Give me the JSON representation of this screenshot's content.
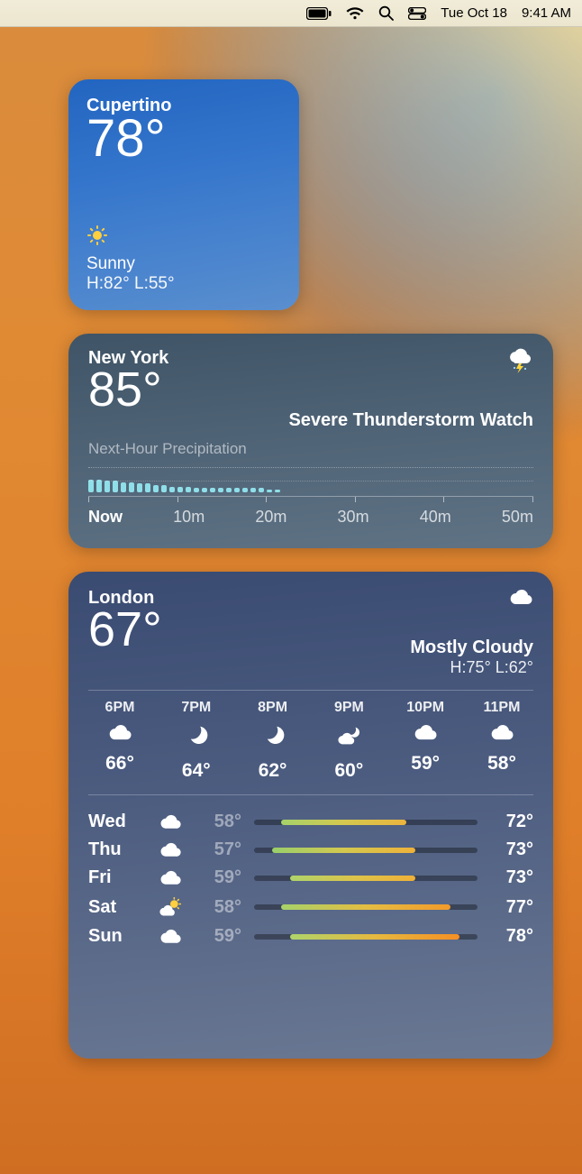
{
  "menubar": {
    "date": "Tue Oct 18",
    "time": "9:41 AM"
  },
  "widgets": {
    "small": {
      "location": "Cupertino",
      "temp": "78°",
      "icon": "sun-icon",
      "condition": "Sunny",
      "hilo": "H:82° L:55°"
    },
    "medium": {
      "location": "New York",
      "temp": "85°",
      "icon": "thunderstorm-icon",
      "alert": "Severe Thunderstorm Watch",
      "precip_label": "Next-Hour Precipitation",
      "precip_axis": [
        "Now",
        "10m",
        "20m",
        "30m",
        "40m",
        "50m"
      ],
      "precip_bars": [
        9,
        9,
        8,
        8,
        7,
        7,
        6,
        6,
        5,
        5,
        4,
        4,
        4,
        3,
        3,
        3,
        3,
        3,
        3,
        3,
        3,
        3,
        2,
        2
      ]
    },
    "large": {
      "location": "London",
      "temp": "67°",
      "icon": "cloud-icon",
      "condition": "Mostly Cloudy",
      "hilo": "H:75° L:62°",
      "hourly": [
        {
          "hour": "6PM",
          "icon": "cloud-icon",
          "temp": "66°"
        },
        {
          "hour": "7PM",
          "icon": "moon-stars-icon",
          "temp": "64°"
        },
        {
          "hour": "8PM",
          "icon": "moon-stars-icon",
          "temp": "62°"
        },
        {
          "hour": "9PM",
          "icon": "cloud-moon-icon",
          "temp": "60°"
        },
        {
          "hour": "10PM",
          "icon": "cloud-icon",
          "temp": "59°"
        },
        {
          "hour": "11PM",
          "icon": "cloud-icon",
          "temp": "58°"
        }
      ],
      "daily_scale": {
        "min": 55,
        "max": 80
      },
      "daily": [
        {
          "day": "Wed",
          "icon": "cloud-icon",
          "lo": 58,
          "hi": 72,
          "lo_text": "58°",
          "hi_text": "72°",
          "gradient": "linear-gradient(90deg,#a6d26a,#d4c84f,#ecb43e)"
        },
        {
          "day": "Thu",
          "icon": "cloud-icon",
          "lo": 57,
          "hi": 73,
          "lo_text": "57°",
          "hi_text": "73°",
          "gradient": "linear-gradient(90deg,#99cf6b,#d4c84f,#eeb23a)"
        },
        {
          "day": "Fri",
          "icon": "cloud-icon",
          "lo": 59,
          "hi": 73,
          "lo_text": "59°",
          "hi_text": "73°",
          "gradient": "linear-gradient(90deg,#aed46b,#dcc44b,#efb138)"
        },
        {
          "day": "Sat",
          "icon": "partly-sunny-icon",
          "lo": 58,
          "hi": 77,
          "lo_text": "58°",
          "hi_text": "77°",
          "gradient": "linear-gradient(90deg,#a6d26a,#e4bd43,#f39a2a)"
        },
        {
          "day": "Sun",
          "icon": "cloud-icon",
          "lo": 59,
          "hi": 78,
          "lo_text": "59°",
          "hi_text": "78°",
          "gradient": "linear-gradient(90deg,#aed46b,#e7b93f,#f48f24)"
        }
      ]
    }
  }
}
